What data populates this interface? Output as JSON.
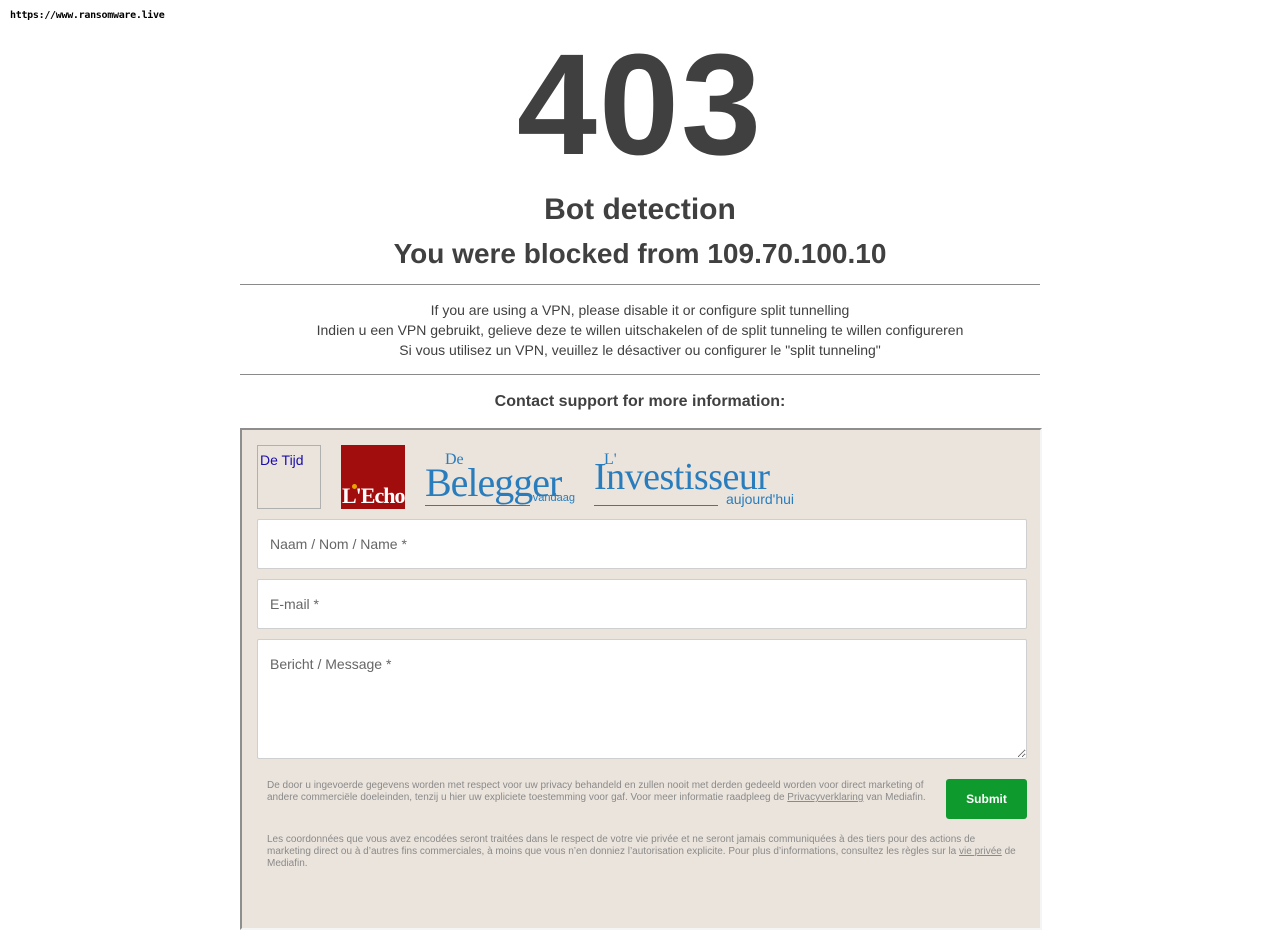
{
  "watermark": "https://www.ransomware.live",
  "error": {
    "code": "403",
    "title": "Bot detection",
    "blocked_message": "You were blocked from 109.70.100.10"
  },
  "vpn_notice": {
    "en": "If you are using a VPN, please disable it or configure split tunnelling",
    "nl": "Indien u een VPN gebruikt, gelieve deze te willen uitschakelen of de split tunneling te willen configureren",
    "fr": "Si vous utilisez un VPN, veuillez le désactiver ou configurer le \"split tunneling\""
  },
  "contact_heading": "Contact support for more information:",
  "logos": {
    "tijd_alt": "De Tijd",
    "echo": "L'Echo",
    "belegger_prefix": "De",
    "belegger_main": "Belegger",
    "belegger_sub": "vandaag",
    "investisseur_prefix": "L'",
    "investisseur_main": "Investisseur",
    "investisseur_sub": "aujourd'hui"
  },
  "form": {
    "name_placeholder": "Naam / Nom / Name *",
    "email_placeholder": "E-mail *",
    "message_placeholder": "Bericht / Message *",
    "submit_label": "Submit",
    "legal_nl_text": "De door u ingevoerde gegevens worden met respect voor uw privacy behandeld en zullen nooit met derden gedeeld worden voor direct marketing of andere commerciële doeleinden, tenzij u hier uw expliciete toestemming voor gaf. Voor meer informatie raadpleeg de",
    "legal_nl_link": "Privacyverklaring",
    "legal_nl_suffix": "van Mediafin.",
    "legal_fr_text": "Les coordonnées que vous avez encodées seront traitées dans le respect de votre vie privée et ne seront jamais communiquées à des tiers pour des actions de marketing direct ou à d’autres fins commerciales, à moins que vous n’en donniez l’autorisation explicite. Pour plus d’informations, consultez les règles sur la",
    "legal_fr_link": "vie privée",
    "legal_fr_suffix": "de Mediafin."
  },
  "colors": {
    "text": "#404040",
    "form_background": "#ebe4dc",
    "submit": "#0e9a2c",
    "logo_blue": "#2a7dbd",
    "echo_red": "#a10c0c"
  }
}
